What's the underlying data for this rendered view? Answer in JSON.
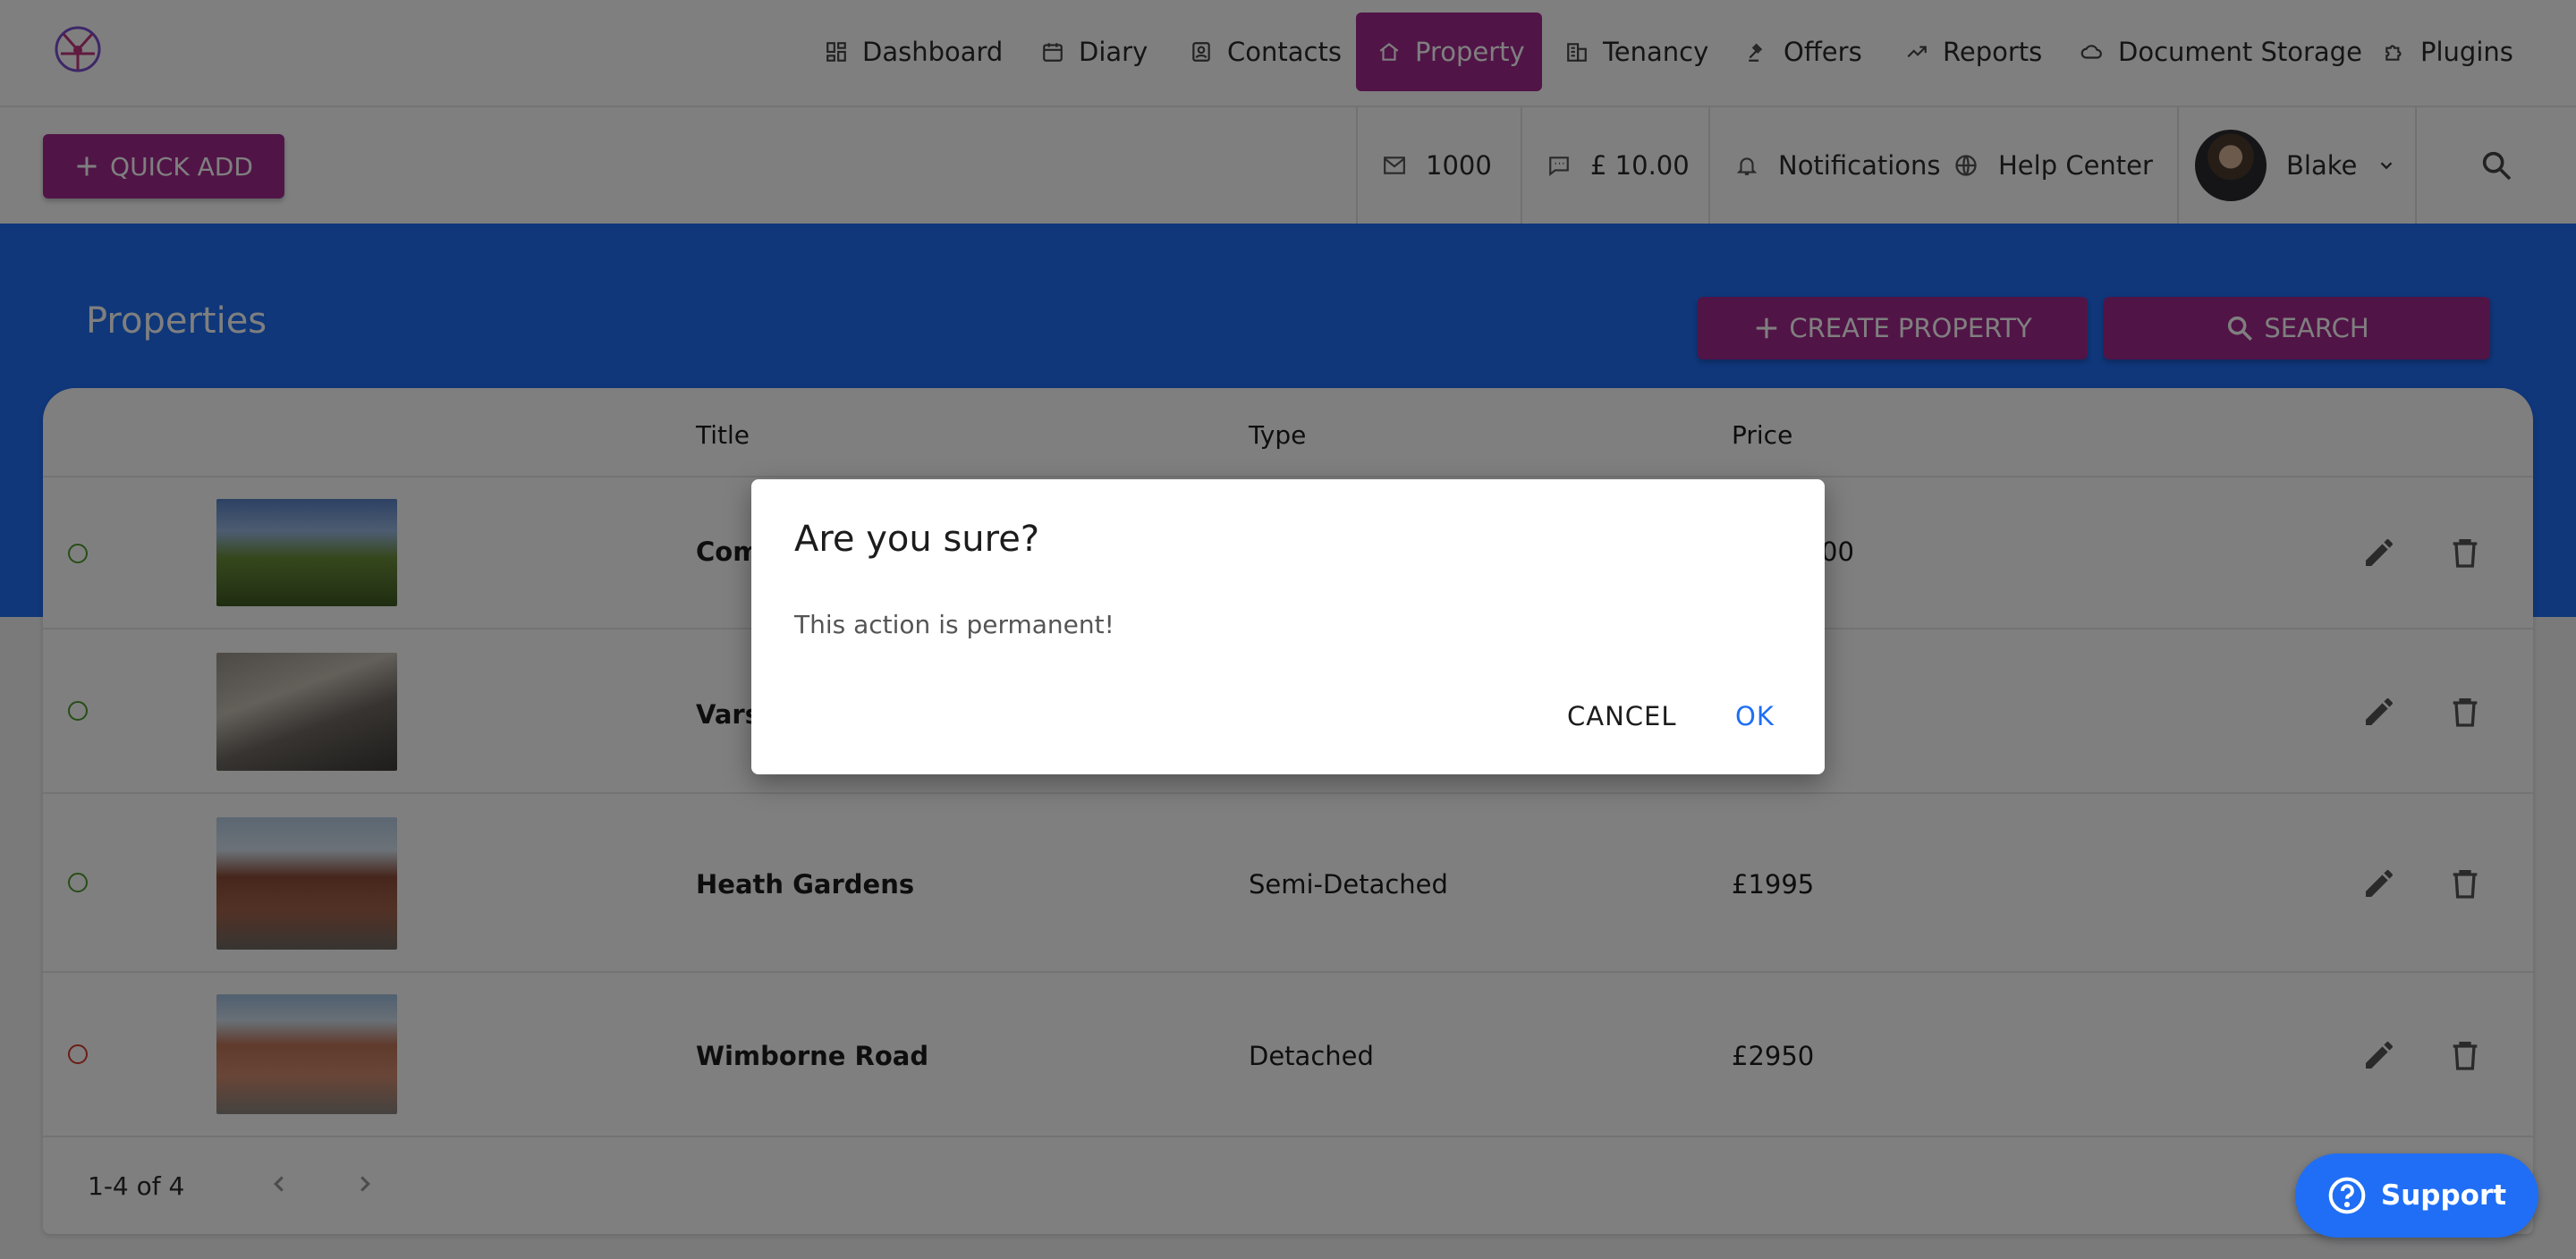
{
  "nav": {
    "items": [
      {
        "label": "Dashboard",
        "icon": "dashboard-icon"
      },
      {
        "label": "Diary",
        "icon": "calendar-icon"
      },
      {
        "label": "Contacts",
        "icon": "contacts-icon"
      },
      {
        "label": "Property",
        "icon": "home-icon",
        "active": true
      },
      {
        "label": "Tenancy",
        "icon": "building-icon"
      },
      {
        "label": "Offers",
        "icon": "gavel-icon"
      },
      {
        "label": "Reports",
        "icon": "trending-icon"
      },
      {
        "label": "Document Storage",
        "icon": "cloud-icon"
      },
      {
        "label": "Plugins",
        "icon": "puzzle-icon"
      }
    ]
  },
  "subbar": {
    "quick_add": "QUICK ADD",
    "email_count": "1000",
    "sms_credit": "£ 10.00",
    "notifications": "Notifications",
    "help_center": "Help Center",
    "user_name": "Blake"
  },
  "page": {
    "title": "Properties",
    "create_label": "CREATE PROPERTY",
    "search_label": "SEARCH"
  },
  "table": {
    "columns": {
      "title": "Title",
      "type": "Type",
      "price": "Price"
    },
    "rows": [
      {
        "status": "active",
        "title": "Com",
        "type": "",
        "price": "00"
      },
      {
        "status": "active",
        "title": "Vars",
        "type": "",
        "price": ""
      },
      {
        "status": "active",
        "title": "Heath Gardens",
        "type": "Semi-Detached",
        "price": "£1995"
      },
      {
        "status": "inactive",
        "title": "Wimborne Road",
        "type": "Detached",
        "price": "£2950"
      }
    ],
    "pagination": "1-4 of 4"
  },
  "dialog": {
    "title": "Are you sure?",
    "message": "This action is permanent!",
    "cancel_label": "CANCEL",
    "ok_label": "OK"
  },
  "support": {
    "label": "Support"
  },
  "colors": {
    "brand": "#a3288f",
    "primary": "#1f6ef5",
    "active_status": "#4e9a2c",
    "inactive_status": "#d93a2a"
  }
}
